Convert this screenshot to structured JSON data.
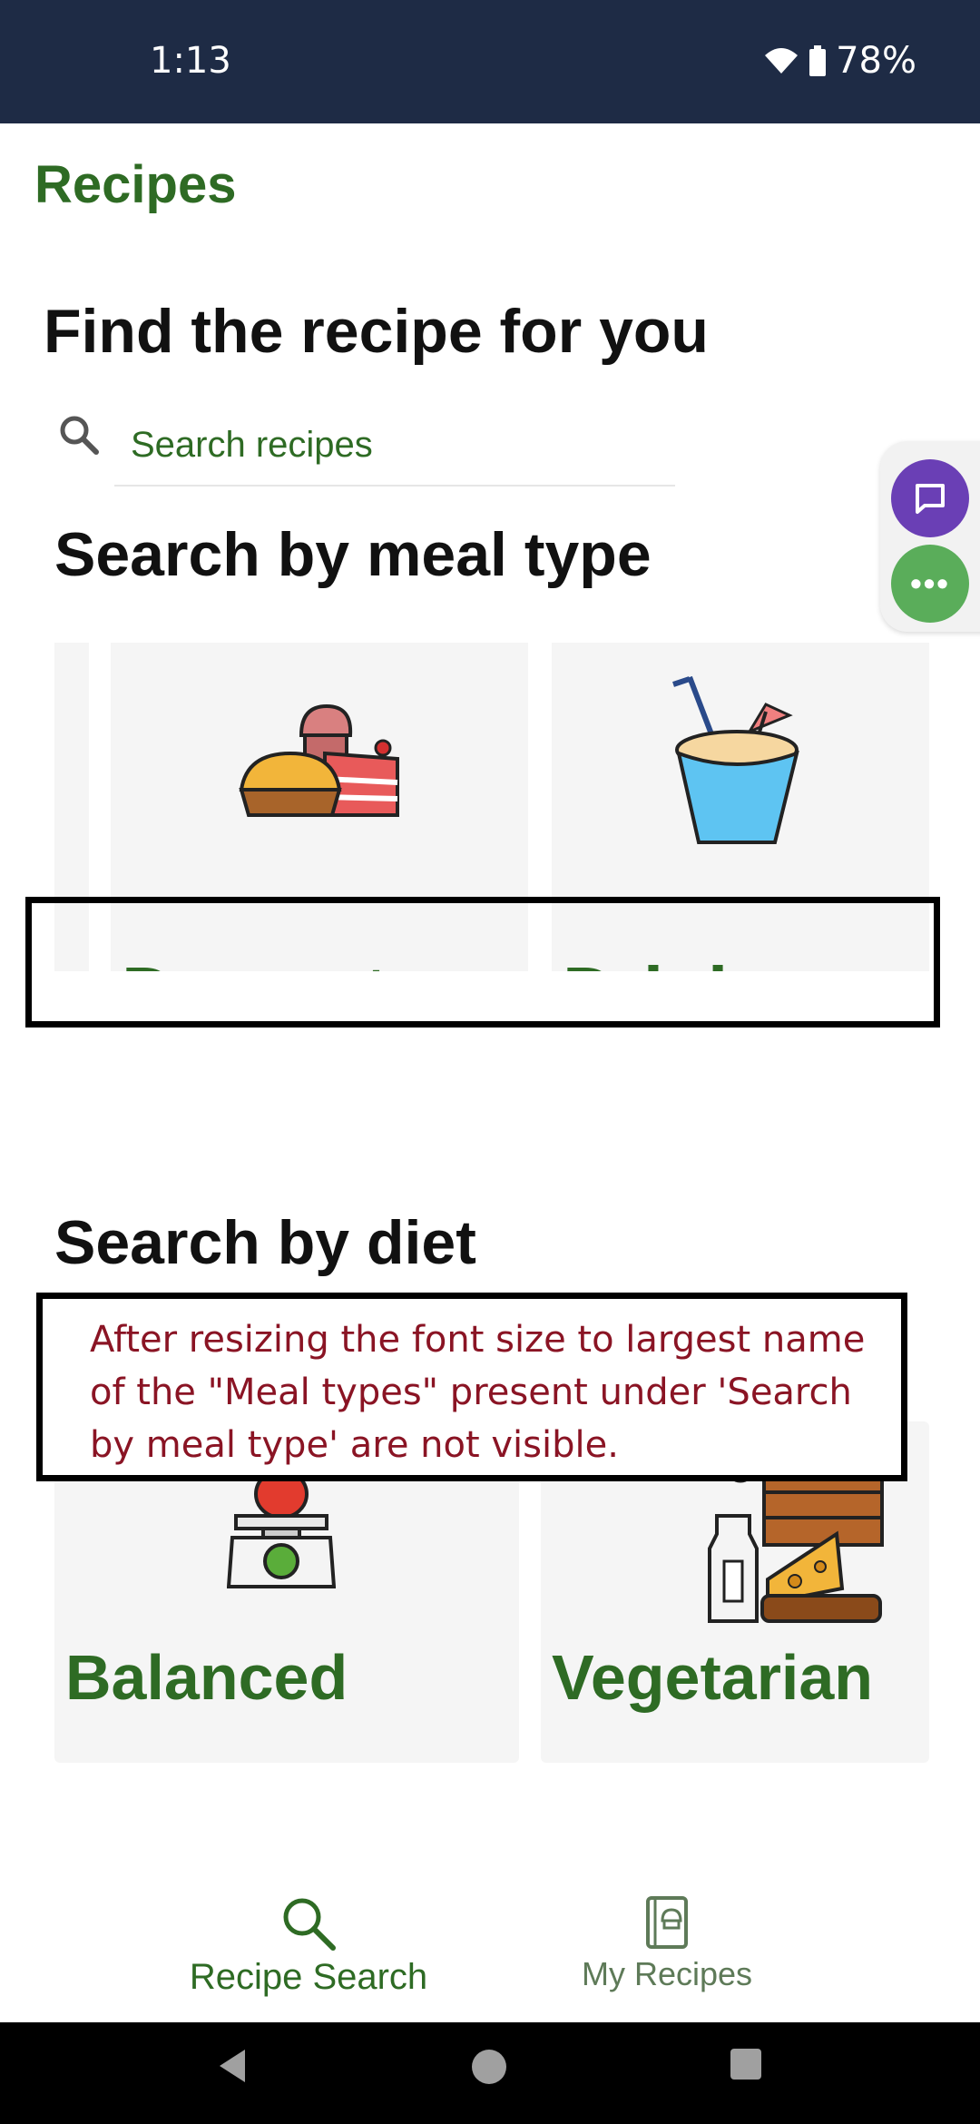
{
  "status_bar": {
    "time": "1:13",
    "battery": "78%"
  },
  "app": {
    "title": "Recipes"
  },
  "headline": "Find the recipe for you",
  "search": {
    "placeholder": "Search recipes"
  },
  "meal_type": {
    "title": "Search by meal type",
    "cards": [
      {
        "label": "Desserts",
        "icon": "dessert-icon"
      },
      {
        "label": "Drinks",
        "icon": "drink-icon"
      }
    ]
  },
  "diet": {
    "title": "Search by diet",
    "cards": [
      {
        "label": "Balanced",
        "icon": "scale-apple-icon"
      },
      {
        "label": "Vegetarian",
        "icon": "vegetarian-food-icon"
      }
    ]
  },
  "annotation": {
    "note": "After resizing the font size to largest name of the \"Meal types\" present under 'Search by meal type' are not visible.",
    "color": "#8a1424"
  },
  "bottom_nav": {
    "items": [
      {
        "label": "Recipe Search",
        "icon": "search-icon",
        "active": true
      },
      {
        "label": "My Recipes",
        "icon": "recipe-book-icon",
        "active": false
      }
    ]
  },
  "colors": {
    "accent": "#2e6b24",
    "status_bar": "#1e2b45",
    "chat": "#6a3fb5",
    "more": "#5aad5a"
  }
}
